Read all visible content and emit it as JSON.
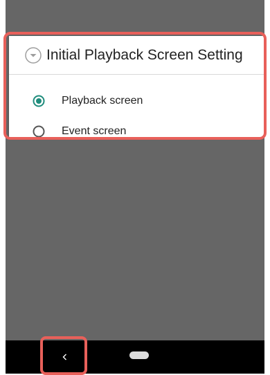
{
  "dialog": {
    "title": "Initial Playback Screen Setting",
    "title_icon": "chevron-down-circle-icon",
    "options": [
      {
        "label": "Playback screen",
        "selected": true
      },
      {
        "label": "Event screen",
        "selected": false
      }
    ]
  },
  "navbar": {
    "back_icon": "back-chevron-icon",
    "home_icon": "home-pill-icon"
  },
  "colors": {
    "highlight": "#e8605a",
    "radio_selected": "#1f8c7c",
    "scrim": "#666666"
  }
}
